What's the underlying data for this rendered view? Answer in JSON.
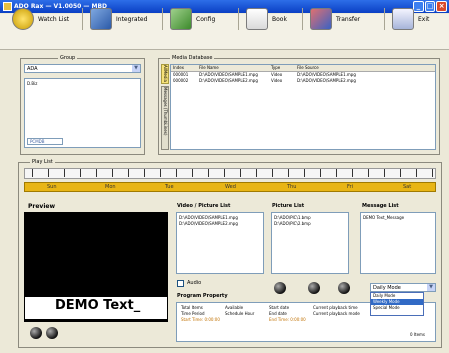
{
  "window": {
    "title": "ADO Rax — V1.0050 — MBD"
  },
  "toolbar": {
    "buttons": [
      {
        "label": "Watch List",
        "icon": "clock-icon"
      },
      {
        "label": "Integrated",
        "icon": "integrated-icon"
      },
      {
        "label": "Config",
        "icon": "config-icon"
      },
      {
        "label": "Book",
        "icon": "book-icon"
      },
      {
        "label": "Transfer",
        "icon": "transfer-icon"
      },
      {
        "label": "Exit",
        "icon": "exit-icon"
      }
    ]
  },
  "group": {
    "legend": "Group",
    "select_value": "ADA",
    "items": [
      "D.Biz"
    ],
    "footer_select": "PCMDB"
  },
  "media_database": {
    "legend": "Media Database",
    "vertical_tab_top": "AllMedia",
    "vertical_tab_bottom": "Messages (ThumbLines)",
    "columns": [
      "Index",
      "File Name",
      "Type",
      "File Source"
    ],
    "rows": [
      [
        "000001",
        "D:\\ADO\\VIDEO\\SAMPLE1.mpg",
        "Video",
        "D:\\ADO\\VIDEO\\SAMPLE1.mpg"
      ],
      [
        "000002",
        "D:\\ADO\\VIDEO\\SAMPLE2.mpg",
        "Video",
        "D:\\ADO\\VIDEO\\SAMPLE2.mpg"
      ]
    ]
  },
  "play_list": {
    "legend": "Play List",
    "lanes": [
      "Sun",
      "Mon",
      "Tue",
      "Wed",
      "Thu",
      "Fri",
      "Sat"
    ]
  },
  "preview": {
    "label": "Preview",
    "demo_text": "DEMO Text_"
  },
  "video_picture_list": {
    "label": "Video / Picture List",
    "items": [
      "D:\\ADO\\VIDEO\\SAMPLE1.mpg",
      "D:\\ADO\\VIDEO\\SAMPLE2.mpg"
    ]
  },
  "picture_list": {
    "label": "Picture List",
    "items": [
      "D:\\ADO\\PIC\\1.bmp",
      "D:\\ADO\\PIC\\2.bmp"
    ]
  },
  "message_list": {
    "label": "Message List",
    "items": [
      "DEMO Text_Message"
    ]
  },
  "checkbox": {
    "label": "Audio"
  },
  "program_property": {
    "label": "Program Property",
    "rows": [
      [
        "Total Items",
        "Available",
        "Start date",
        "Current playback time"
      ],
      [
        "Time Period",
        "Schedule Hour",
        "End date",
        "Current playback mode"
      ],
      [
        "Start Time: 0:00:00",
        "End Time: 0:00:00"
      ]
    ]
  },
  "mode_dropdown": {
    "value": "Daily Mode",
    "options": [
      "Daily Mode",
      "Weekly Mode",
      "Special Mode"
    ],
    "selected_index": 1
  },
  "footer_text": "0 Items"
}
